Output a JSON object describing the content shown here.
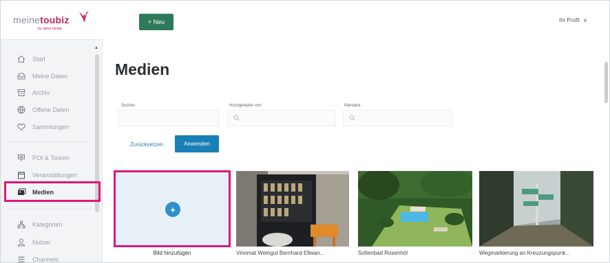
{
  "app": {
    "logo_prefix": "meine",
    "logo_brand": "toubiz",
    "logo_sub": "by opera media",
    "new_button": "+ Neu",
    "profile_label": "Ihr Profil",
    "profile_chevron": "∨"
  },
  "sidebar": {
    "items": [
      {
        "label": "Start",
        "icon": "home-icon"
      },
      {
        "label": "Meine Daten",
        "icon": "inbox-icon"
      },
      {
        "label": "Archiv",
        "icon": "archive-icon"
      },
      {
        "label": "Offene Daten",
        "icon": "globe-icon"
      },
      {
        "label": "Sammlungen",
        "icon": "heart-icon"
      },
      {
        "label": "POI & Touren",
        "icon": "poi-icon"
      },
      {
        "label": "Veranstaltungen",
        "icon": "calendar-icon"
      },
      {
        "label": "Medien",
        "icon": "media-icon",
        "active": true
      },
      {
        "label": "Kategorien",
        "icon": "hierarchy-icon"
      },
      {
        "label": "Nutzer",
        "icon": "user-icon"
      },
      {
        "label": "Channels",
        "icon": "channels-icon"
      }
    ]
  },
  "main": {
    "title": "Medien",
    "filters": [
      {
        "label": "Suchen",
        "placeholder": ""
      },
      {
        "label": "Hochgeladen von",
        "placeholder": "Q"
      },
      {
        "label": "Mandant",
        "placeholder": "Q"
      }
    ],
    "reset_button": "Zurücksetzen",
    "apply_button": "Anwenden",
    "add_tile": {
      "icon": "+",
      "caption": "Bild hinzufügen"
    },
    "media": [
      {
        "caption": "Vinomat Weingut Bernhard Ellwan..."
      },
      {
        "caption": "Sofienbad Rosenhöl"
      },
      {
        "caption": "Wegmarkierung an Kreuzungspunk..."
      }
    ]
  },
  "colors": {
    "accent_green": "#2c7a57",
    "accent_blue": "#1a7fb6",
    "highlight_pink": "#e0177a"
  }
}
